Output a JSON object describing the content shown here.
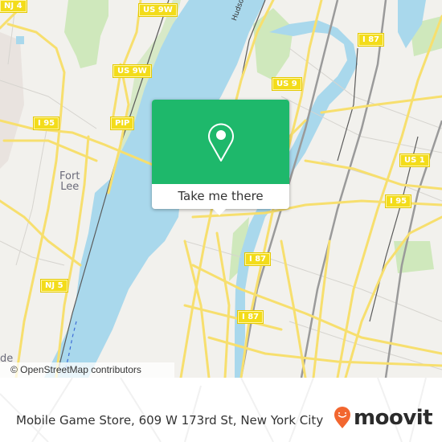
{
  "map": {
    "colors": {
      "land": "#f2f1ed",
      "water": "#a9d8ec",
      "park": "#cfe8bc",
      "road": "#f7df6e",
      "rail": "#8a8a8a"
    },
    "shields": [
      {
        "label": "NJ 4"
      },
      {
        "label": "US 9W"
      },
      {
        "label": "US 9W"
      },
      {
        "label": "I 95"
      },
      {
        "label": "PIP"
      },
      {
        "label": "US 9"
      },
      {
        "label": "I 87"
      },
      {
        "label": "US 1"
      },
      {
        "label": "I 95"
      },
      {
        "label": "I 87"
      },
      {
        "label": "NJ 5"
      },
      {
        "label": "I 87"
      }
    ],
    "place_labels": {
      "fort_lee": "Fort\nLee",
      "partial_de": "de"
    },
    "water_labels": {
      "hudson": "Hudson"
    },
    "attribution": "© OpenStreetMap contributors"
  },
  "popup": {
    "icon": "map-pin-icon",
    "button_label": "Take me there",
    "accent_color": "#1eb86b"
  },
  "footer": {
    "location_text": "Mobile Game Store, 609 W 173rd St, New York City",
    "brand": {
      "icon": "moovit-pin-icon",
      "name": "moovit",
      "color": "#f2662f"
    }
  }
}
